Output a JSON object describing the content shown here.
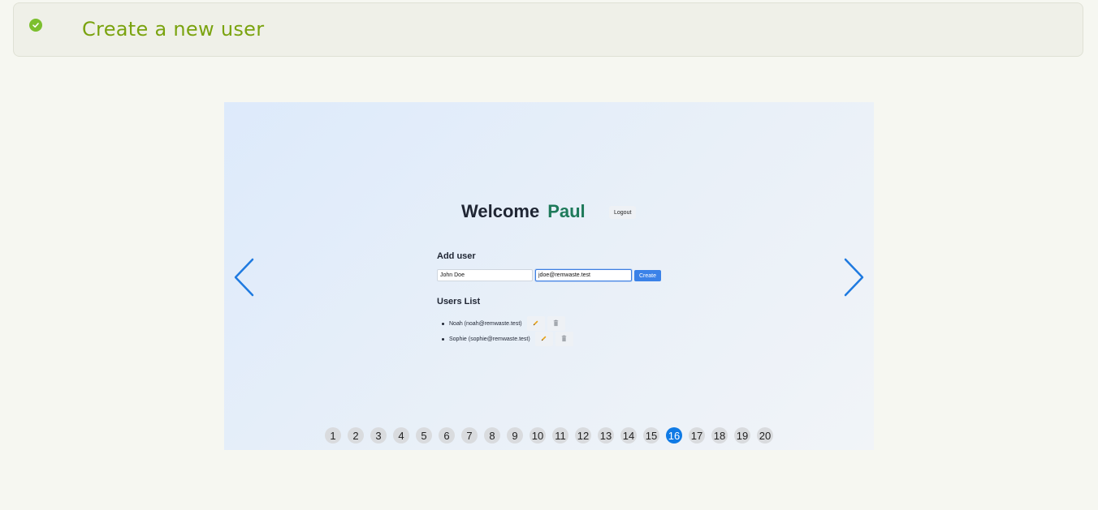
{
  "test": {
    "status_icon": "check-circle-icon",
    "title": "Create a new user"
  },
  "app": {
    "welcome_label": "Welcome",
    "username": "Paul",
    "logout_label": "Logout",
    "add_user": {
      "heading": "Add user",
      "name_value": "John Doe",
      "email_value": "jdoe@remwaste.test",
      "create_label": "Create"
    },
    "users_list": {
      "heading": "Users List",
      "items": [
        {
          "text": "Noah (noah@remwaste.test)",
          "edit_icon": "pencil-icon",
          "delete_icon": "trash-icon"
        },
        {
          "text": "Sophie (sophie@remwaste.test)",
          "edit_icon": "pencil-icon",
          "delete_icon": "trash-icon"
        }
      ]
    }
  },
  "viewer": {
    "prev_icon": "chevron-left-icon",
    "next_icon": "chevron-right-icon",
    "pages": [
      "1",
      "2",
      "3",
      "4",
      "5",
      "6",
      "7",
      "8",
      "9",
      "10",
      "11",
      "12",
      "13",
      "14",
      "15",
      "16",
      "17",
      "18",
      "19",
      "20"
    ],
    "current_page": "16"
  },
  "colors": {
    "accent": "#0f7ae5",
    "pass": "#7cbf2e",
    "title": "#7aa30f",
    "username": "#1e7a5a"
  }
}
